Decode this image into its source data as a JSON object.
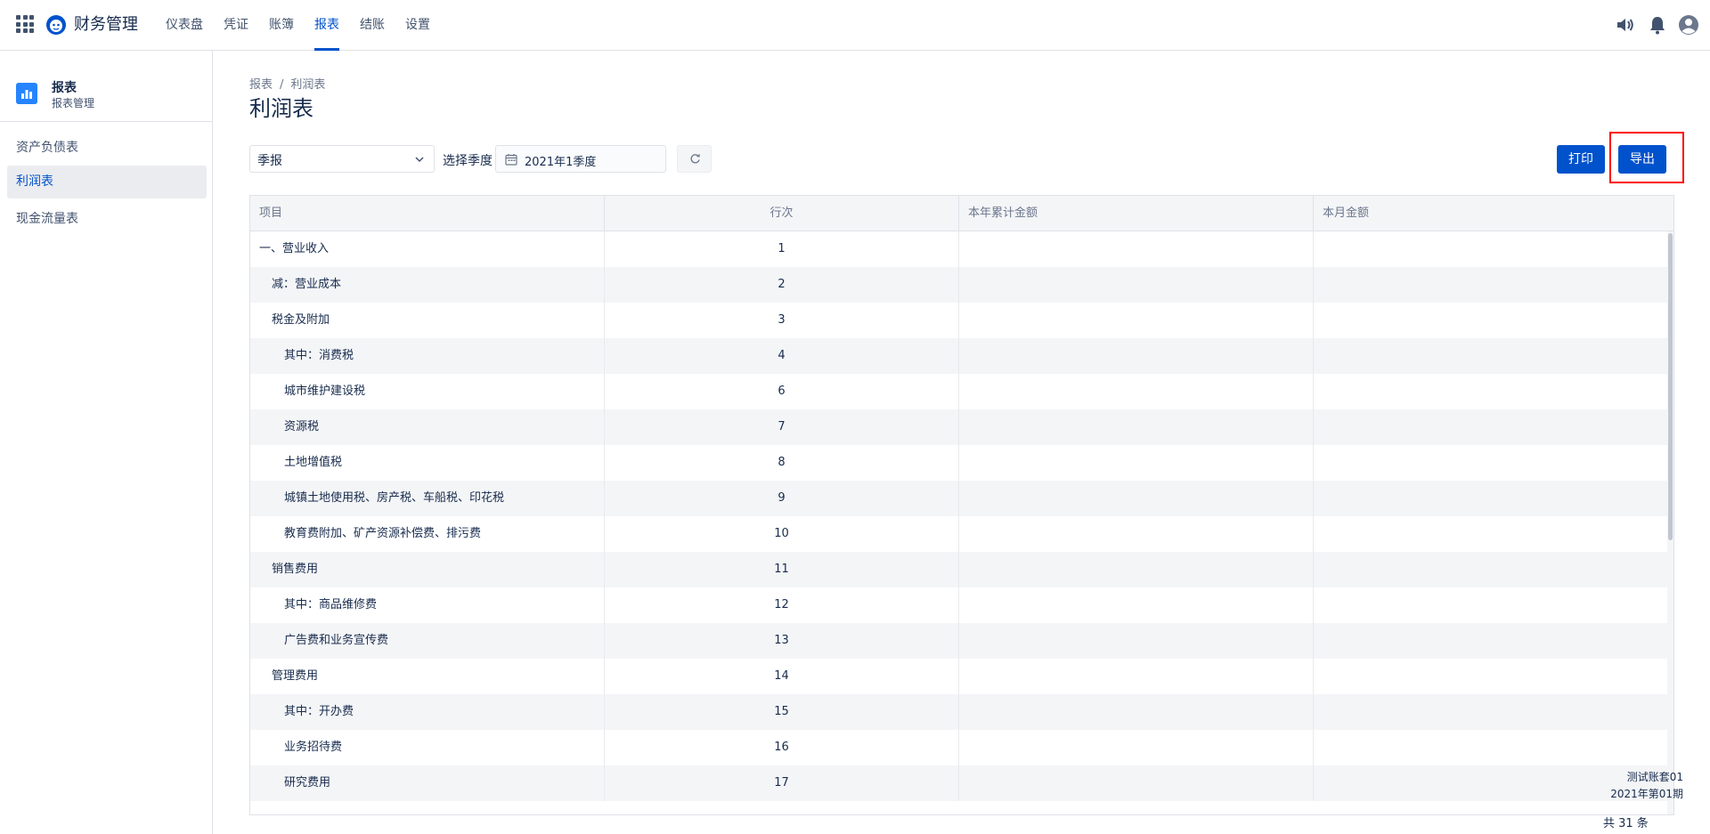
{
  "app": {
    "name": "财务管理"
  },
  "nav": {
    "items": [
      {
        "label": "仪表盘",
        "active": false
      },
      {
        "label": "凭证",
        "active": false
      },
      {
        "label": "账簿",
        "active": false
      },
      {
        "label": "报表",
        "active": true
      },
      {
        "label": "结账",
        "active": false
      },
      {
        "label": "设置",
        "active": false
      }
    ]
  },
  "icons": {
    "apps": "apps-grid-icon",
    "logo": "monkey-logo-icon",
    "speaker": "speaker-icon",
    "bell": "bell-icon",
    "user": "user-avatar-icon"
  },
  "sidebar": {
    "title": "报表",
    "subtitle": "报表管理",
    "items": [
      {
        "label": "资产负债表",
        "active": false
      },
      {
        "label": "利润表",
        "active": true
      },
      {
        "label": "现金流量表",
        "active": false
      }
    ]
  },
  "breadcrumb": {
    "root": "报表",
    "separator": "/",
    "current": "利润表"
  },
  "page": {
    "title": "利润表"
  },
  "filters": {
    "period_type": "季报",
    "quarter_label": "选择季度",
    "quarter_value": "2021年1季度"
  },
  "actions": {
    "print": "打印",
    "export": "导出"
  },
  "table": {
    "headers": [
      "项目",
      "行次",
      "本年累计金额",
      "本月金额"
    ],
    "rows": [
      {
        "item": "一、营业收入",
        "line": "1",
        "indent": 0,
        "ytd": "",
        "month": ""
      },
      {
        "item": "减：营业成本",
        "line": "2",
        "indent": 1,
        "ytd": "",
        "month": ""
      },
      {
        "item": "税金及附加",
        "line": "3",
        "indent": 1,
        "ytd": "",
        "month": ""
      },
      {
        "item": "其中：消费税",
        "line": "4",
        "indent": 2,
        "ytd": "",
        "month": ""
      },
      {
        "item": "城市维护建设税",
        "line": "6",
        "indent": 2,
        "ytd": "",
        "month": ""
      },
      {
        "item": "资源税",
        "line": "7",
        "indent": 2,
        "ytd": "",
        "month": ""
      },
      {
        "item": "土地增值税",
        "line": "8",
        "indent": 2,
        "ytd": "",
        "month": ""
      },
      {
        "item": "城镇土地使用税、房产税、车船税、印花税",
        "line": "9",
        "indent": 2,
        "ytd": "",
        "month": ""
      },
      {
        "item": "教育费附加、矿产资源补偿费、排污费",
        "line": "10",
        "indent": 2,
        "ytd": "",
        "month": ""
      },
      {
        "item": "销售费用",
        "line": "11",
        "indent": 1,
        "ytd": "",
        "month": ""
      },
      {
        "item": "其中：商品维修费",
        "line": "12",
        "indent": 2,
        "ytd": "",
        "month": ""
      },
      {
        "item": "广告费和业务宣传费",
        "line": "13",
        "indent": 2,
        "ytd": "",
        "month": ""
      },
      {
        "item": "管理费用",
        "line": "14",
        "indent": 1,
        "ytd": "",
        "month": ""
      },
      {
        "item": "其中：开办费",
        "line": "15",
        "indent": 2,
        "ytd": "",
        "month": ""
      },
      {
        "item": "业务招待费",
        "line": "16",
        "indent": 2,
        "ytd": "",
        "month": ""
      },
      {
        "item": "研究费用",
        "line": "17",
        "indent": 2,
        "ytd": "",
        "month": ""
      }
    ],
    "scroll_position": 0.0
  },
  "footer": {
    "account_set": "测试账套01",
    "period": "2021年第01期",
    "total": "共 31 条"
  },
  "colors": {
    "primary": "#0052cc",
    "highlight": "#ff0000",
    "row_alt": "#f4f5f7"
  }
}
